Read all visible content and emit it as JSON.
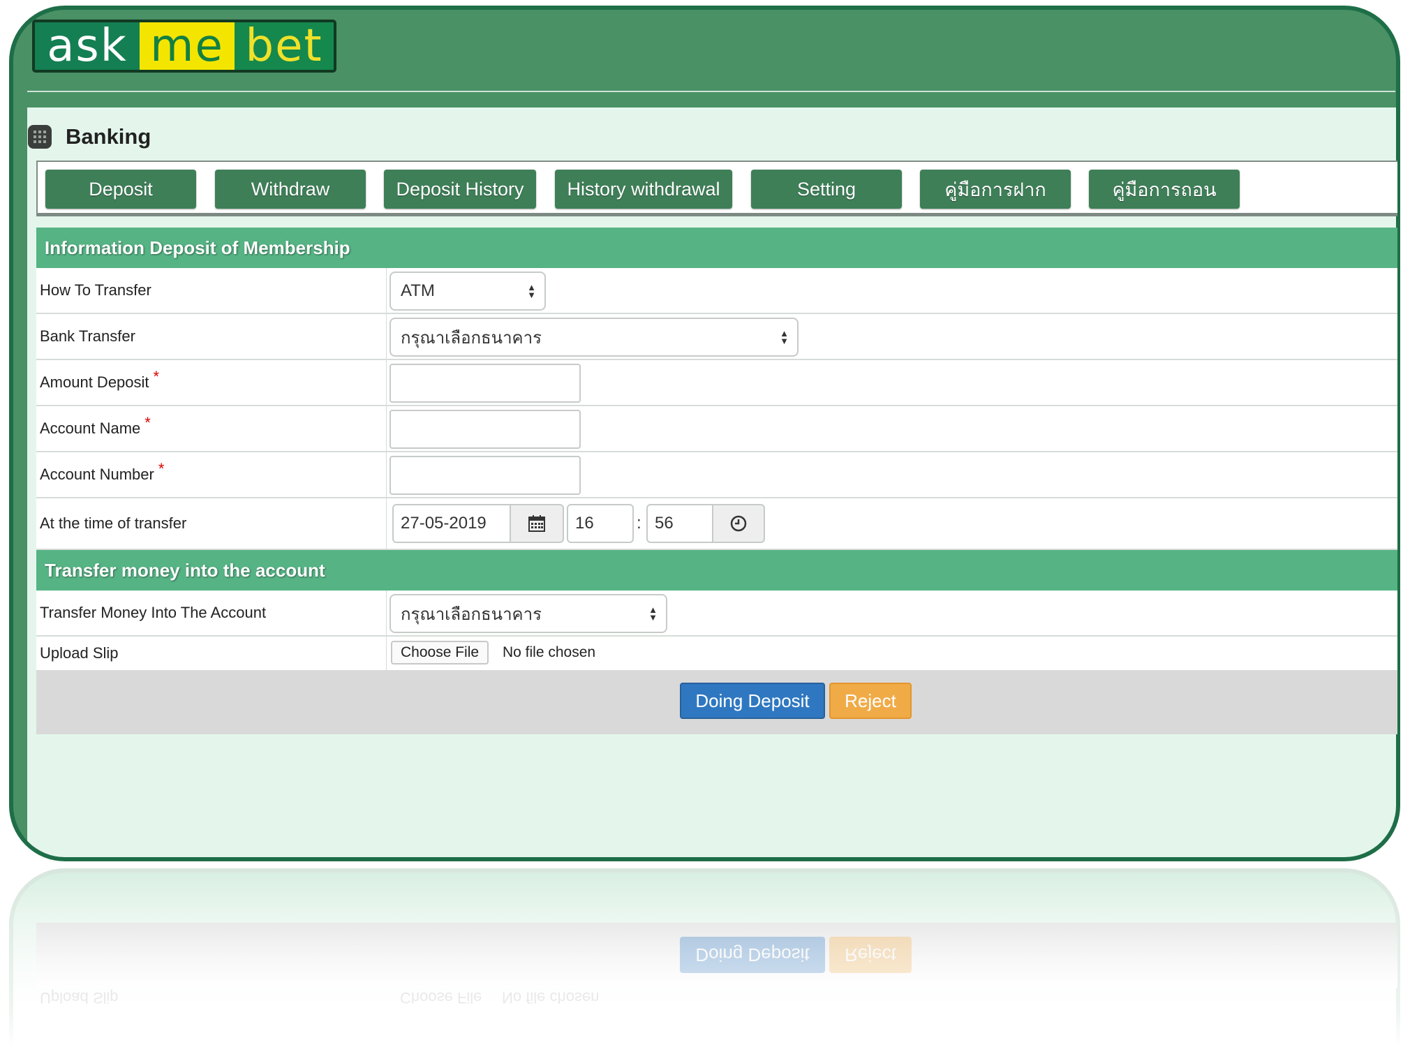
{
  "brand": {
    "part1": "ask",
    "part2": "me",
    "part3": "bet"
  },
  "panel": {
    "title": "Banking",
    "icon": "grid-icon"
  },
  "nav": {
    "deposit": "Deposit",
    "withdraw": "Withdraw",
    "deposit_history": "Deposit History",
    "history_withdrawal": "History withdrawal",
    "setting": "Setting",
    "deposit_manual": "คู่มือการฝาก",
    "withdraw_manual": "คู่มือการถอน"
  },
  "section1": {
    "title": "Information Deposit of Membership"
  },
  "form": {
    "how_to_transfer": {
      "label": "How To Transfer",
      "value": "ATM"
    },
    "bank_transfer": {
      "label": "Bank Transfer",
      "value": "กรุณาเลือกธนาคาร"
    },
    "amount_deposit": {
      "label": "Amount Deposit",
      "value": ""
    },
    "account_name": {
      "label": "Account Name",
      "value": ""
    },
    "account_number": {
      "label": "Account Number",
      "value": ""
    },
    "time_of_transfer": {
      "label": "At the time of transfer",
      "date": "27-05-2019",
      "hour": "16",
      "separator": ":",
      "minute": "56"
    },
    "required_mark": "*"
  },
  "section2": {
    "title": "Transfer money into the account"
  },
  "transfer": {
    "into_account": {
      "label": "Transfer Money Into The Account",
      "value": "กรุณาเลือกธนาคาร"
    },
    "upload_slip": {
      "label": "Upload Slip",
      "button": "Choose File",
      "status": "No file chosen"
    }
  },
  "actions": {
    "submit": "Doing Deposit",
    "reject": "Reject"
  },
  "colors": {
    "frame": "#4a9166",
    "nav_button": "#3e7f58",
    "section_header": "#55b384",
    "panel_bg": "#e4f6ec",
    "primary": "#2f78c1",
    "warning": "#f0ab47"
  }
}
